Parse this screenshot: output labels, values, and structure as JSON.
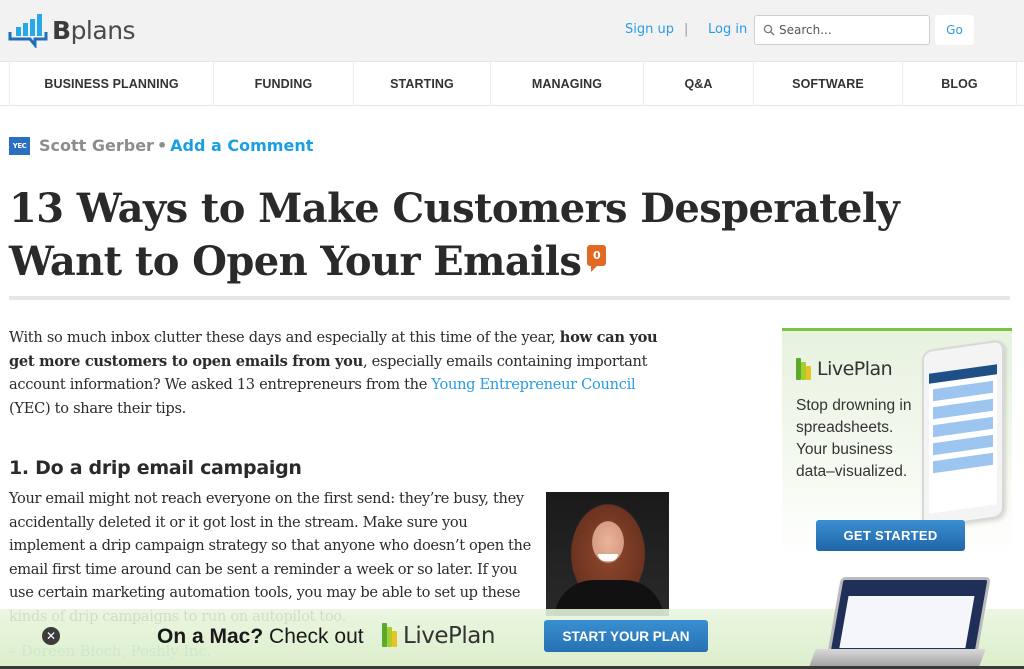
{
  "header": {
    "logo_text_bold": "B",
    "logo_text_rest": "plans",
    "signup": "Sign up",
    "separator": "|",
    "login": "Log in",
    "search_placeholder": "Search...",
    "go_label": "Go",
    "icons": {
      "logo": "bar-chart-speech-bubble-icon",
      "search": "magnifier-icon"
    }
  },
  "nav": {
    "items": [
      {
        "label": "BUSINESS PLANNING"
      },
      {
        "label": "FUNDING"
      },
      {
        "label": "STARTING"
      },
      {
        "label": "MANAGING"
      },
      {
        "label": "Q&A"
      },
      {
        "label": "SOFTWARE"
      },
      {
        "label": "BLOG"
      }
    ]
  },
  "article": {
    "author_badge": "YEC",
    "author": "Scott Gerber",
    "byline_separator": "•",
    "add_comment": "Add a Comment",
    "title": "13 Ways to Make Customers Desperately Want to Open Your Emails",
    "comment_count": "0",
    "intro": {
      "part1": "With so much inbox clutter these days and especially at this time of the year, ",
      "bold": "how can you get more customers to open emails from you",
      "part2": ", especially emails containing important account information? We asked 13 entrepreneurs from the ",
      "link": "Young Entrepreneur Council",
      "part3": " (YEC) to share their tips."
    },
    "section1": {
      "heading": "1. Do a drip email campaign",
      "body": "Your email might not reach everyone on the first send: they’re busy, they accidentally deleted it or it got lost in the stream. Make sure you implement a drip campaign strategy so that anyone who doesn’t open the email first time around can be sent a reminder a week or so later. If you use certain marketing automation tools, you may be able to set up these kinds of drip campaigns to run on autopilot too.",
      "attribution": "– Doreen Bloch, Poshly Inc.",
      "photo": "portrait-photo"
    }
  },
  "sidebar_ad": {
    "brand": "LivePlan",
    "copy": "Stop drowning in spreadsheets. Your business data–visualized.",
    "cta": "GET STARTED",
    "accent": "#7cc243",
    "button_color": "#2a78bd"
  },
  "bottom_banner": {
    "close": "✕",
    "text_bold": "On a Mac?",
    "text_rest": " Check out",
    "brand": "LivePlan",
    "cta": "START YOUR PLAN"
  },
  "colors": {
    "link": "#2b9be3",
    "comment_badge": "#e06a24",
    "yec": "#2b6fc2"
  }
}
